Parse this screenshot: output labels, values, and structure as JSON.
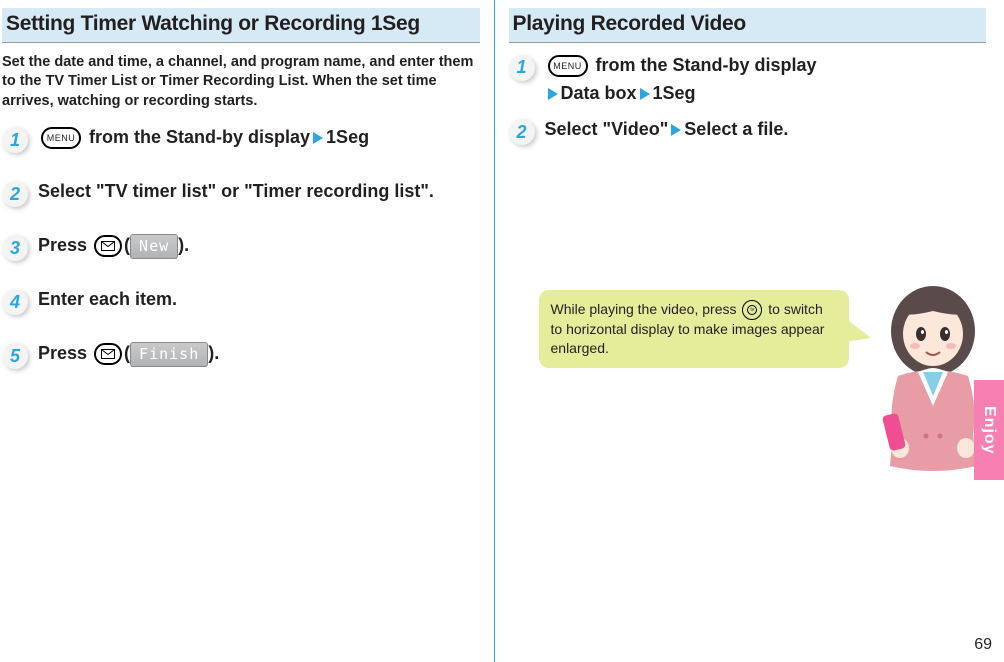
{
  "left": {
    "title": "Setting Timer Watching or Recording 1Seg",
    "intro": "Set the date and time, a channel, and program name, and enter them to the TV Timer List or Timer Recording List. When the set time arrives, watching or recording starts.",
    "steps": {
      "1": {
        "num": "1",
        "menu_label": "MENU",
        "after_menu": "from the Stand-by display",
        "tail": "1Seg"
      },
      "2": {
        "num": "2",
        "text": "Select \"TV timer list\" or \"Timer recording list\"."
      },
      "3": {
        "num": "3",
        "pre": "Press ",
        "paren_open": "(",
        "pill": "New",
        "paren_close": ")."
      },
      "4": {
        "num": "4",
        "text": "Enter each item."
      },
      "5": {
        "num": "5",
        "pre": "Press ",
        "paren_open": "(",
        "pill": "Finish",
        "paren_close": ")."
      }
    }
  },
  "right": {
    "title": "Playing Recorded Video",
    "steps": {
      "1": {
        "num": "1",
        "menu_label": "MENU",
        "after_menu": "from the Stand-by display",
        "link1": "Data box",
        "link2": "1Seg"
      },
      "2": {
        "num": "2",
        "pre": "Select \"Video\"",
        "tail": "Select a file."
      }
    },
    "tip": {
      "t1": "While playing the video, press ",
      "t2": " to switch to horizontal display to make images appear enlarged."
    }
  },
  "side_tab": "Enjoy",
  "page_num": "69"
}
